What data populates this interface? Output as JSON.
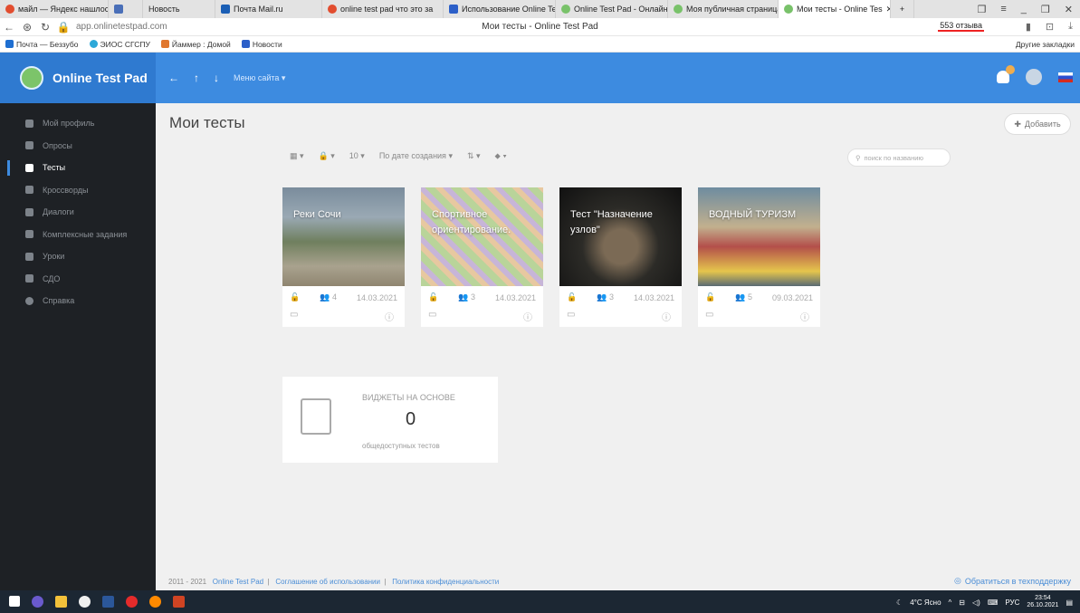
{
  "browser": {
    "tabs": [
      {
        "label": "майл — Яндекс нашлось",
        "color": "#e24d2f"
      },
      {
        "label": "",
        "color": "#4a6fb8"
      },
      {
        "label": "Новость",
        "color": ""
      },
      {
        "label": "Почта Mail.ru",
        "color": "#1b5fb5"
      },
      {
        "label": "online test pad что это за",
        "color": "#e24d2f"
      },
      {
        "label": "Использование Online Te",
        "color": "#2c5fc8"
      },
      {
        "label": "Online Test Pad - Онлайн",
        "color": "#79c26a"
      },
      {
        "label": "Моя публичная страница",
        "color": "#79c26a"
      },
      {
        "label": "Мои тесты - Online Tes",
        "color": "#79c26a"
      }
    ],
    "url": "app.onlinetestpad.com",
    "page_title": "Мои тесты - Online Test Pad",
    "reviews": "553 отзыва",
    "bookmarks": [
      "Почта — Беззубо",
      "ЭИОС СГСПУ",
      "Йаммер : Домой",
      "Новости"
    ],
    "other_bookmarks": "Другие закладки"
  },
  "app": {
    "brand": "Online Test Pad",
    "menu_label": "Меню сайта",
    "sidebar": [
      {
        "label": "Мой профиль",
        "icon": "user-icon"
      },
      {
        "label": "Опросы",
        "icon": "survey-icon"
      },
      {
        "label": "Тесты",
        "icon": "test-icon",
        "active": true
      },
      {
        "label": "Кроссворды",
        "icon": "crossword-icon"
      },
      {
        "label": "Диалоги",
        "icon": "dialog-icon"
      },
      {
        "label": "Комплексные задания",
        "icon": "tasks-icon"
      },
      {
        "label": "Уроки",
        "icon": "lessons-icon"
      },
      {
        "label": "СДО",
        "icon": "lms-icon"
      },
      {
        "label": "Справка",
        "icon": "help-icon"
      }
    ],
    "main_title": "Мои тесты",
    "add_label": "Добавить",
    "toolbar": {
      "count": "10",
      "sort": "По дате создания"
    },
    "search_placeholder": "поиск по названию",
    "cards": [
      {
        "title": "Реки Сочи",
        "users": "4",
        "date": "14.03.2021"
      },
      {
        "title": "Спортивное ориентирование.",
        "users": "3",
        "date": "14.03.2021"
      },
      {
        "title": "Тест \"Назначение узлов\"",
        "users": "3",
        "date": "14.03.2021"
      },
      {
        "title": "ВОДНЫЙ ТУРИЗМ",
        "users": "5",
        "date": "09.03.2021"
      }
    ],
    "widget": {
      "title": "ВИДЖЕТЫ НА ОСНОВЕ",
      "count": "0",
      "subtitle": "общедоступных тестов"
    },
    "footer": {
      "years": "2011 - 2021",
      "brand": "Online Test Pad",
      "terms": "Соглашение об использовании",
      "privacy": "Политика конфиденциальности",
      "support": "Обратиться в техподдержку"
    }
  },
  "taskbar": {
    "weather": "4°C Ясно",
    "lang": "РУС",
    "time": "23:54",
    "date": "26.10.2021"
  }
}
